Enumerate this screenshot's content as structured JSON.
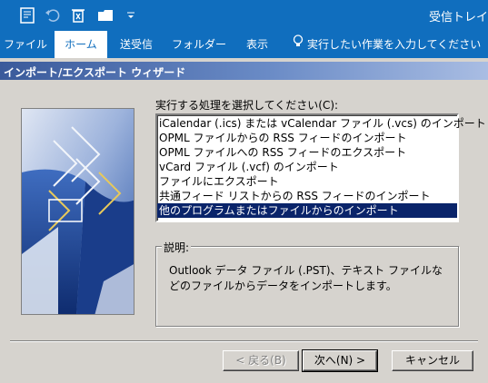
{
  "window": {
    "title": "受信トレイ"
  },
  "qat": {
    "icons": [
      "send-receive-icon",
      "undo-icon",
      "delete-icon",
      "folder-icon",
      "customize-qat-icon"
    ]
  },
  "ribbon": {
    "tabs": [
      {
        "label": "ファイル",
        "active": false
      },
      {
        "label": "ホーム",
        "active": true
      },
      {
        "label": "送受信",
        "active": false
      },
      {
        "label": "フォルダー",
        "active": false
      },
      {
        "label": "表示",
        "active": false
      }
    ],
    "tell_me": "実行したい作業を入力してください"
  },
  "wizard": {
    "title": "インポート/エクスポート ウィザード",
    "prompt": "実行する処理を選択してください(C):",
    "actions": [
      "iCalendar (.ics) または vCalendar ファイル (.vcs) のインポート",
      "OPML ファイルからの RSS フィードのインポート",
      "OPML ファイルへの RSS フィードのエクスポート",
      "vCard ファイル (.vcf) のインポート",
      "ファイルにエクスポート",
      "共通フィード リストからの RSS フィードのインポート",
      "他のプログラムまたはファイルからのインポート"
    ],
    "selected_index": 6,
    "description_label": "説明:",
    "description": "Outlook データ ファイル (.PST)、テキスト ファイルなどのファイルからデータをインポートします。",
    "buttons": {
      "back": "< 戻る(B)",
      "next": "次へ(N) >",
      "cancel": "キャンセル"
    }
  },
  "colors": {
    "ribbon": "#106ebe",
    "selection": "#0a246a",
    "dialog": "#d6d3ce"
  }
}
